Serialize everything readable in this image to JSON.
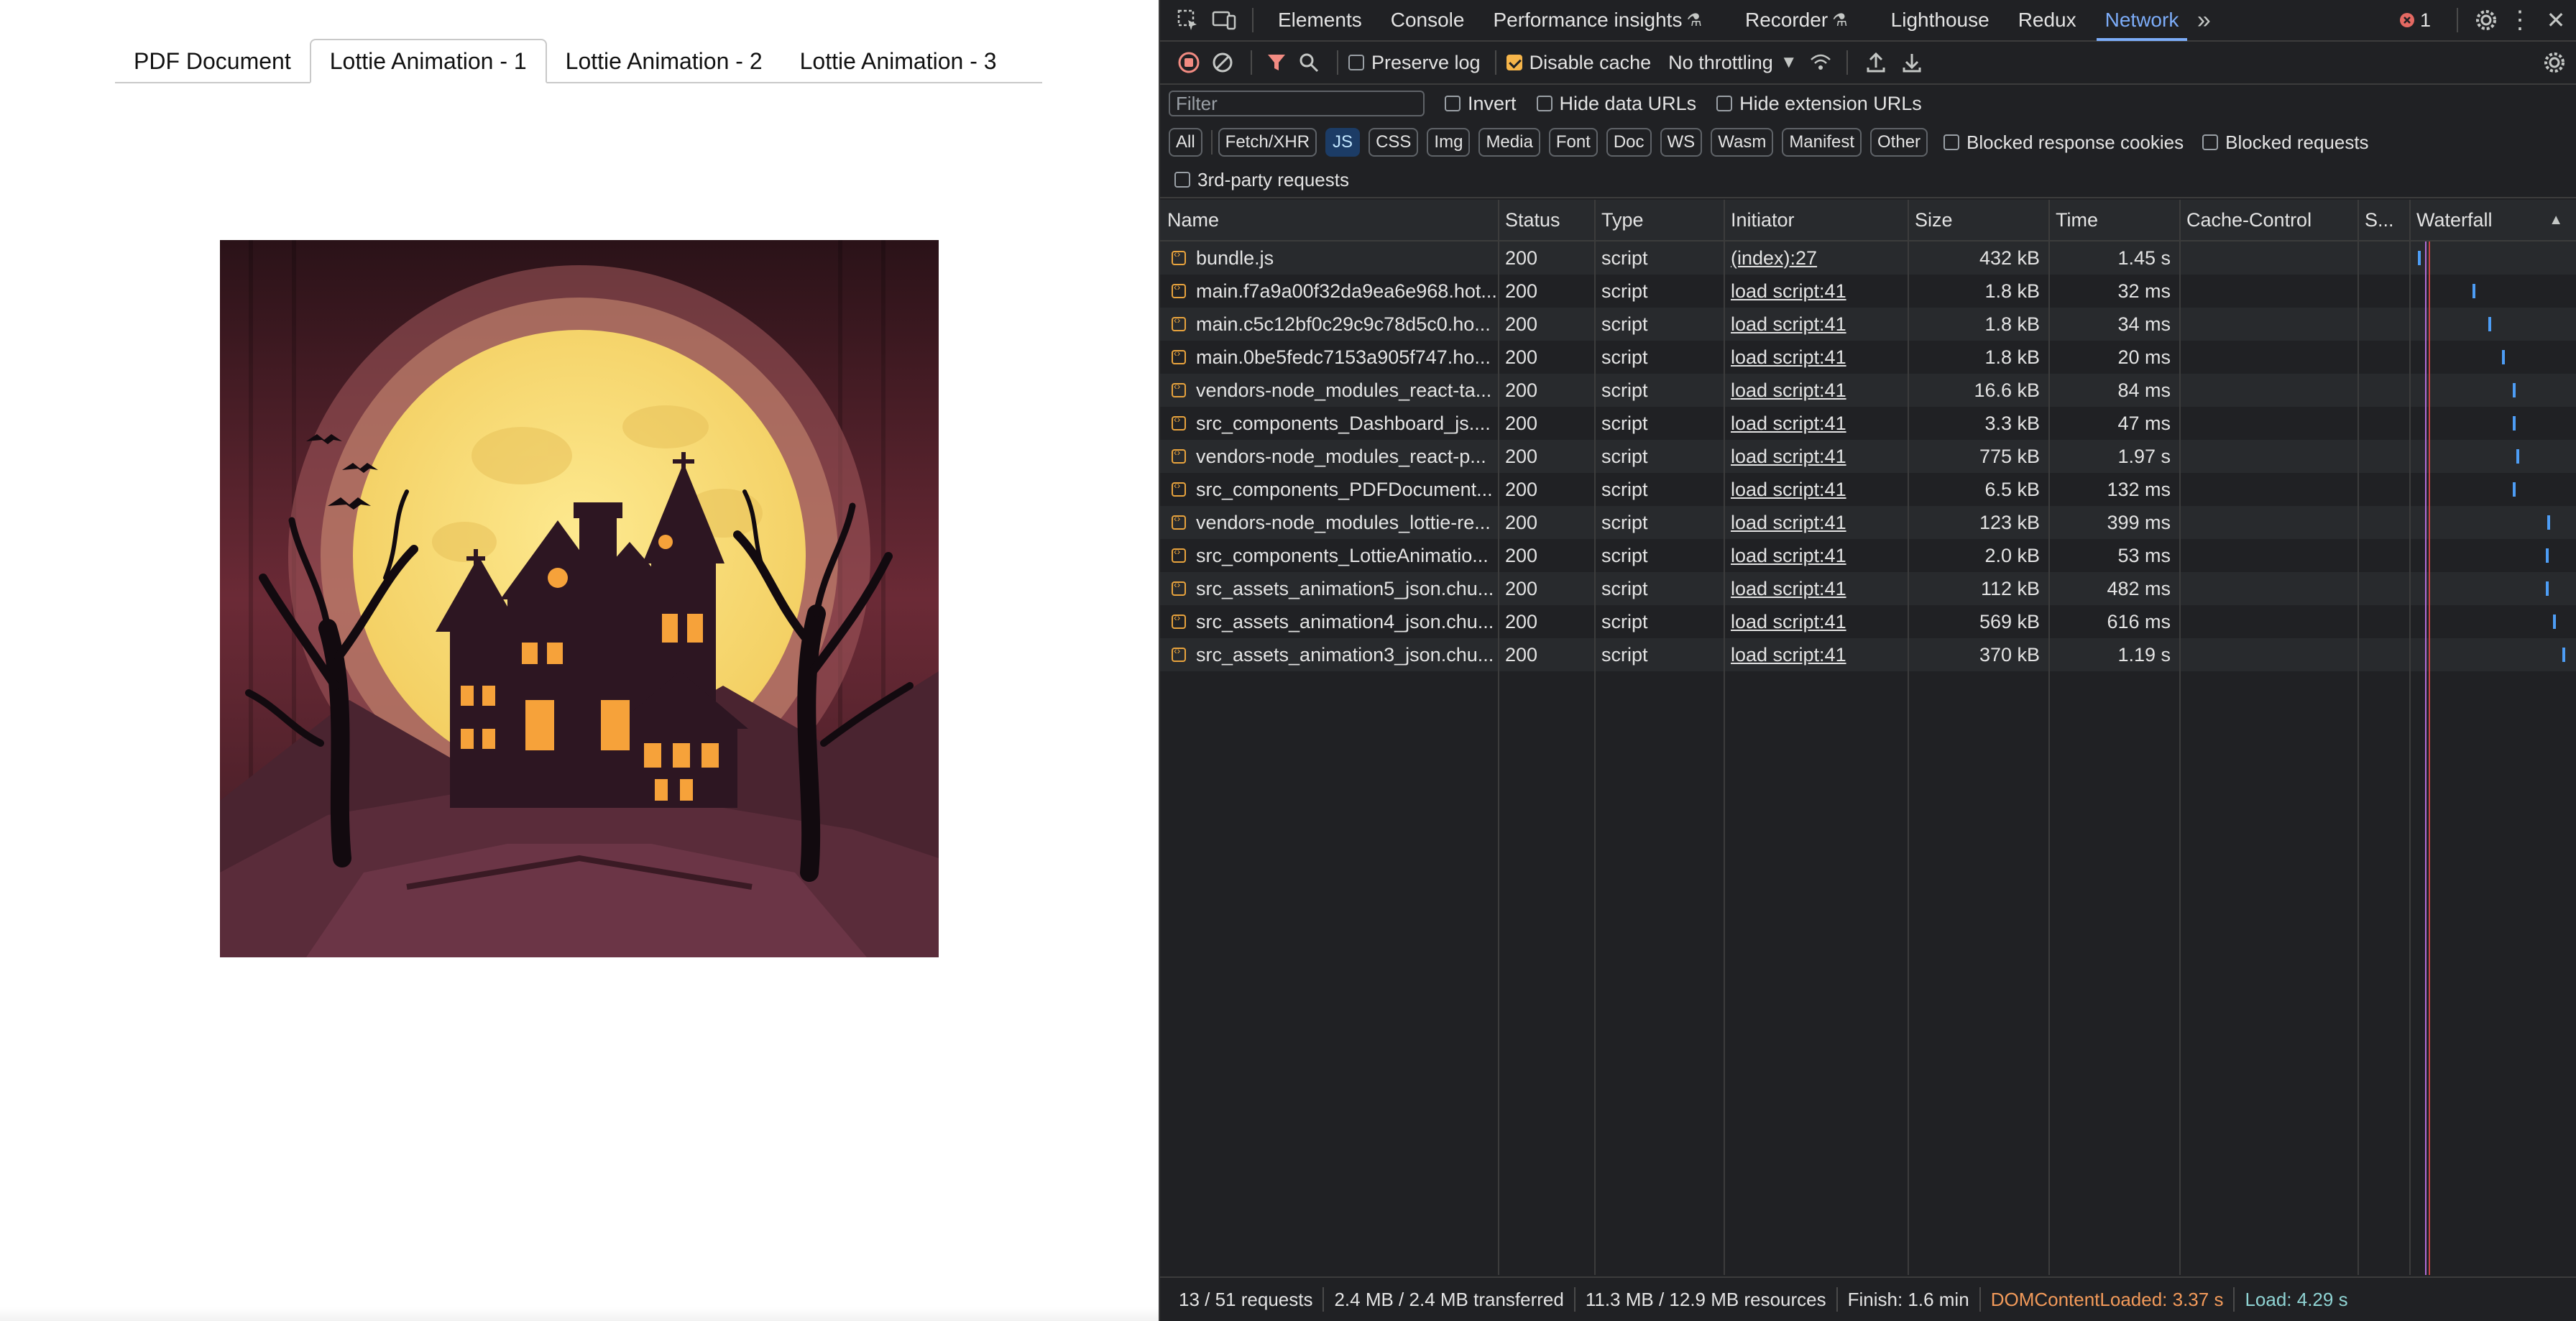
{
  "app": {
    "tabs": [
      "PDF Document",
      "Lottie Animation - 1",
      "Lottie Animation - 2",
      "Lottie Animation - 3"
    ],
    "active_tab": "Lottie Animation - 1",
    "animation_description": "Haunted house silhouette in front of a full moon with bats and bare trees"
  },
  "devtools": {
    "top_tabs": [
      "Elements",
      "Console",
      "Performance insights",
      "Recorder",
      "Lighthouse",
      "Redux",
      "Network"
    ],
    "active_tab": "Network",
    "error_count": "1",
    "toolbar": {
      "preserve_log": "Preserve log",
      "disable_cache": "Disable cache",
      "throttling": "No throttling"
    },
    "filter": {
      "placeholder": "Filter",
      "invert": "Invert",
      "hide_data_urls": "Hide data URLs",
      "hide_extension_urls": "Hide extension URLs"
    },
    "type_filters": [
      "All",
      "Fetch/XHR",
      "JS",
      "CSS",
      "Img",
      "Media",
      "Font",
      "Doc",
      "WS",
      "Wasm",
      "Manifest",
      "Other"
    ],
    "active_type": "JS",
    "blocked_response_cookies": "Blocked response cookies",
    "blocked_requests": "Blocked requests",
    "third_party": "3rd-party requests",
    "columns": [
      "Name",
      "Status",
      "Type",
      "Initiator",
      "Size",
      "Time",
      "Cache-Control",
      "S...",
      "Waterfall"
    ],
    "rows": [
      {
        "name": "bundle.js",
        "status": "200",
        "type": "script",
        "initiator": "(index):27",
        "size": "432 kB",
        "time": "1.45 s",
        "wf": 0.03
      },
      {
        "name": "main.f7a9a00f32da9ea6e968.hot...",
        "status": "200",
        "type": "script",
        "initiator": "load script:41",
        "size": "1.8 kB",
        "time": "32 ms",
        "wf": 0.38
      },
      {
        "name": "main.c5c12bf0c29c9c78d5c0.ho...",
        "status": "200",
        "type": "script",
        "initiator": "load script:41",
        "size": "1.8 kB",
        "time": "34 ms",
        "wf": 0.48
      },
      {
        "name": "main.0be5fedc7153a905f747.ho...",
        "status": "200",
        "type": "script",
        "initiator": "load script:41",
        "size": "1.8 kB",
        "time": "20 ms",
        "wf": 0.57
      },
      {
        "name": "vendors-node_modules_react-ta...",
        "status": "200",
        "type": "script",
        "initiator": "load script:41",
        "size": "16.6 kB",
        "time": "84 ms",
        "wf": 0.64
      },
      {
        "name": "src_components_Dashboard_js....",
        "status": "200",
        "type": "script",
        "initiator": "load script:41",
        "size": "3.3 kB",
        "time": "47 ms",
        "wf": 0.64
      },
      {
        "name": "vendors-node_modules_react-p...",
        "status": "200",
        "type": "script",
        "initiator": "load script:41",
        "size": "775 kB",
        "time": "1.97 s",
        "wf": 0.66
      },
      {
        "name": "src_components_PDFDocument...",
        "status": "200",
        "type": "script",
        "initiator": "load script:41",
        "size": "6.5 kB",
        "time": "132 ms",
        "wf": 0.64
      },
      {
        "name": "vendors-node_modules_lottie-re...",
        "status": "200",
        "type": "script",
        "initiator": "load script:41",
        "size": "123 kB",
        "time": "399 ms",
        "wf": 0.86
      },
      {
        "name": "src_components_LottieAnimatio...",
        "status": "200",
        "type": "script",
        "initiator": "load script:41",
        "size": "2.0 kB",
        "time": "53 ms",
        "wf": 0.85
      },
      {
        "name": "src_assets_animation5_json.chu...",
        "status": "200",
        "type": "script",
        "initiator": "load script:41",
        "size": "112 kB",
        "time": "482 ms",
        "wf": 0.85
      },
      {
        "name": "src_assets_animation4_json.chu...",
        "status": "200",
        "type": "script",
        "initiator": "load script:41",
        "size": "569 kB",
        "time": "616 ms",
        "wf": 0.9
      },
      {
        "name": "src_assets_animation3_json.chu...",
        "status": "200",
        "type": "script",
        "initiator": "load script:41",
        "size": "370 kB",
        "time": "1.19 s",
        "wf": 0.96
      }
    ],
    "status_bar": {
      "requests": "13 / 51 requests",
      "transferred": "2.4 MB / 2.4 MB transferred",
      "resources": "11.3 MB / 12.9 MB resources",
      "finish": "Finish: 1.6 min",
      "dom_content_loaded": "DOMContentLoaded: 3.37 s",
      "load": "Load: 4.29 s"
    },
    "colors": {
      "accent": "#7cacf8",
      "dcl": "#f29a5a",
      "load": "#8fd3d3",
      "record": "#f28b82",
      "checkbox": "#f6b54a"
    }
  }
}
